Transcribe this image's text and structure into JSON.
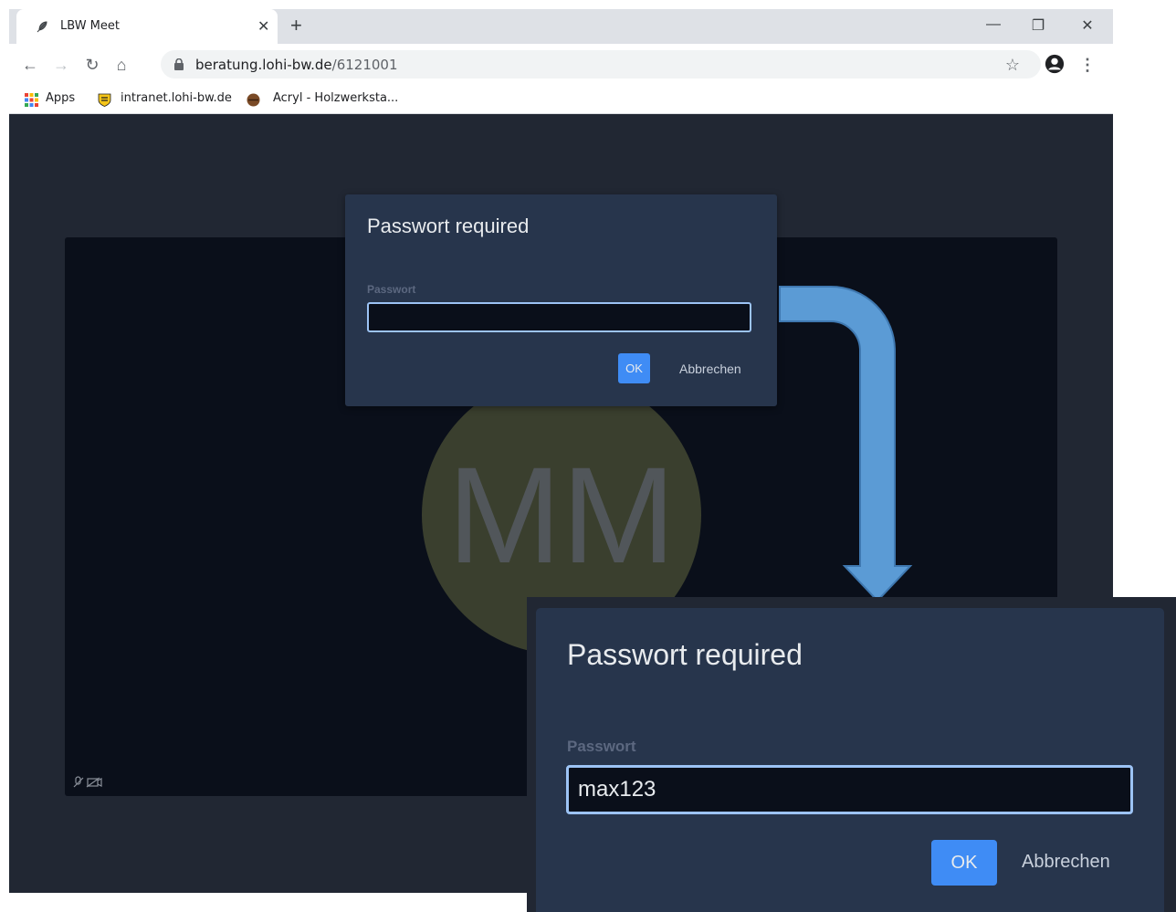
{
  "browser": {
    "tab": {
      "title": "LBW Meet"
    },
    "url": {
      "host": "beratung.lohi-bw.de",
      "path": "/6121001"
    },
    "bookmarks": [
      {
        "label": "Apps"
      },
      {
        "label": "intranet.lohi-bw.de"
      },
      {
        "label": "Acryl - Holzwerksta..."
      }
    ]
  },
  "meeting": {
    "avatar_initials": "MM"
  },
  "dialog": {
    "title": "Passwort required",
    "field_label": "Passwort",
    "value": "",
    "ok_label": "OK",
    "cancel_label": "Abbrechen"
  },
  "zoom_dialog": {
    "title": "Passwort required",
    "field_label": "Passwort",
    "value": "max123",
    "ok_label": "OK",
    "cancel_label": "Abbrechen"
  },
  "colors": {
    "page_bg": "#212733",
    "dialog_bg": "#27354c",
    "input_border": "#9cc3f5",
    "primary_button": "#3f8cf5",
    "arrow": "#5b9bd5"
  }
}
